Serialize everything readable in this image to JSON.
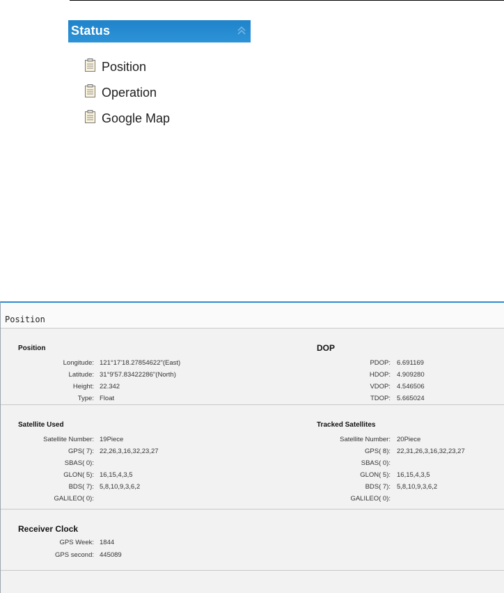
{
  "status_menu": {
    "title": "Status",
    "items": [
      {
        "label": "Position",
        "icon": "document-icon"
      },
      {
        "label": "Operation",
        "icon": "document-icon"
      },
      {
        "label": "Google Map",
        "icon": "document-icon"
      }
    ]
  },
  "panel": {
    "title": "Position",
    "position": {
      "title": "Position",
      "rows": [
        {
          "key": "Longitude:",
          "value": "121°17'18.27854622\"(East)"
        },
        {
          "key": "Latitude:",
          "value": "31°9'57.83422286\"(North)"
        },
        {
          "key": "Height:",
          "value": "22.342"
        },
        {
          "key": "Type:",
          "value": "Float"
        }
      ]
    },
    "dop": {
      "title": "DOP",
      "rows": [
        {
          "key": "PDOP:",
          "value": "6.691169"
        },
        {
          "key": "HDOP:",
          "value": "4.909280"
        },
        {
          "key": "VDOP:",
          "value": "4.546506"
        },
        {
          "key": "TDOP:",
          "value": "5.665024"
        }
      ]
    },
    "satellite_used": {
      "title": "Satellite Used",
      "rows": [
        {
          "key": "Satellite Number:",
          "value": "19Piece"
        },
        {
          "key": "GPS( 7):",
          "value": "22,26,3,16,32,23,27"
        },
        {
          "key": "SBAS( 0):",
          "value": ""
        },
        {
          "key": "GLON( 5):",
          "value": "16,15,4,3,5"
        },
        {
          "key": "BDS( 7):",
          "value": "5,8,10,9,3,6,2"
        },
        {
          "key": "GALILEO( 0):",
          "value": ""
        }
      ]
    },
    "tracked_satellites": {
      "title": "Tracked Satellites",
      "rows": [
        {
          "key": "Satellite Number:",
          "value": "20Piece"
        },
        {
          "key": "GPS( 8):",
          "value": "22,31,26,3,16,32,23,27"
        },
        {
          "key": "SBAS( 0):",
          "value": ""
        },
        {
          "key": "GLON( 5):",
          "value": "16,15,4,3,5"
        },
        {
          "key": "BDS( 7):",
          "value": "5,8,10,9,3,6,2"
        },
        {
          "key": "GALILEO( 0):",
          "value": ""
        }
      ]
    },
    "receiver_clock": {
      "title": "Receiver Clock",
      "rows": [
        {
          "key": "GPS Week:",
          "value": "1844"
        },
        {
          "key": "GPS second:",
          "value": "445089"
        }
      ]
    }
  },
  "colors": {
    "header_blue": "#2d8bd0",
    "panel_bg": "#f2f2f2"
  }
}
